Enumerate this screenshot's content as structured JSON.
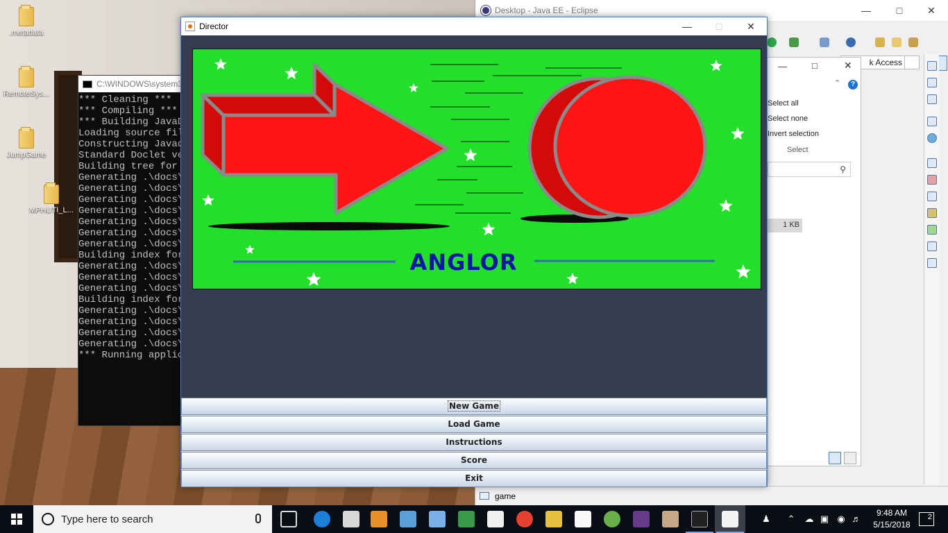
{
  "desktop": {
    "icons": [
      {
        "label": ".metadata"
      },
      {
        "label": "RemoteSys..."
      },
      {
        "label": "JumpGame"
      },
      {
        "label": "MPHUTI_L..."
      }
    ]
  },
  "console": {
    "title": "C:\\WINDOWS\\system3",
    "lines": [
      "*** Cleaning ***",
      "*** Compiling ***",
      "*** Building JavaDo",
      "Loading source file",
      "Constructing Javado",
      "Standard Doclet ver",
      "Building tree for a",
      "Generating .\\docs\\",
      "Generating .\\docs\\",
      "Generating .\\docs\\",
      "Generating .\\docs\\",
      "Generating .\\docs\\",
      "Generating .\\docs\\",
      "Generating .\\docs\\",
      "Building index for",
      "Generating .\\docs\\",
      "Generating .\\docs\\",
      "Generating .\\docs\\",
      "Building index for",
      "Generating .\\docs\\",
      "Generating .\\docs\\",
      "Generating .\\docs\\",
      "Generating .\\docs\\",
      "*** Running applica"
    ]
  },
  "eclipse": {
    "title": "Desktop - Java EE - Eclipse",
    "quick_access": "k Access",
    "select_panel": {
      "select_all": "Select all",
      "select_none": "Select none",
      "invert_selection": "Invert selection",
      "group_label": "Select",
      "size_value": "1 KB"
    },
    "status_item": "game"
  },
  "director": {
    "title": "Director",
    "game_title": "ANGLOR",
    "menu": [
      {
        "label": "New Game",
        "focused": true
      },
      {
        "label": "Load Game"
      },
      {
        "label": "Instructions"
      },
      {
        "label": "Score"
      },
      {
        "label": "Exit"
      }
    ],
    "colors": {
      "banner_background": "#22e02a",
      "arrow_red": "#ff1414",
      "arrow_dark_red": "#d40a0a",
      "outline_gray": "#8a8a8a",
      "title_blue": "#1015a8",
      "content_background": "#343c50"
    }
  },
  "taskbar": {
    "search_placeholder": "Type here to search",
    "time": "9:48 AM",
    "date": "5/15/2018",
    "notification_count": "2",
    "icons": [
      "task-view-icon",
      "edge-icon",
      "store-icon",
      "media-player-icon",
      "virtualbox-icon",
      "3d-box-icon",
      "chart-app-icon",
      "mail-icon",
      "chrome-icon",
      "file-explorer-icon",
      "sticky-notes-icon",
      "android-studio-icon",
      "game-app-icon",
      "paint-icon",
      "cmd-icon",
      "java-icon"
    ]
  }
}
